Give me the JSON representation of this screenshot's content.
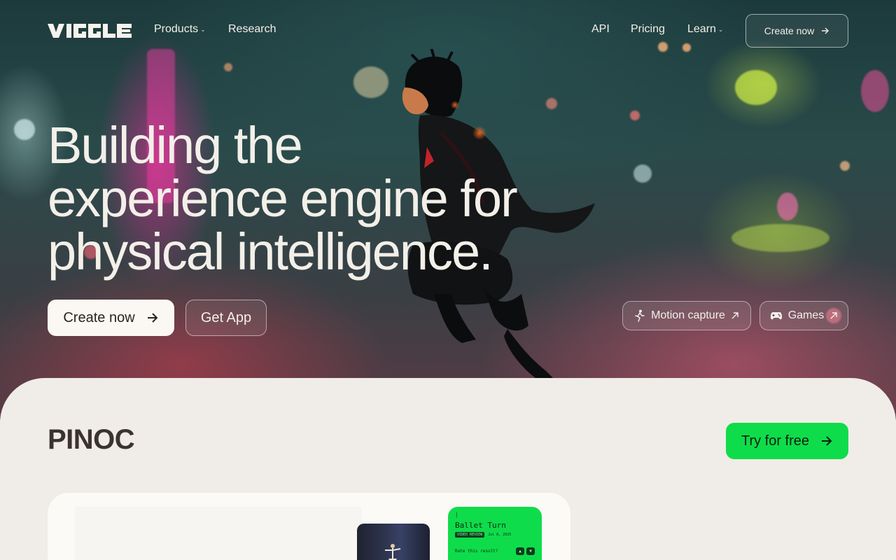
{
  "brand": {
    "name": "VIGGLE"
  },
  "nav": {
    "left": [
      {
        "label": "Products",
        "dropdown": true
      },
      {
        "label": "Research",
        "dropdown": false
      }
    ],
    "right": [
      {
        "label": "API",
        "dropdown": false
      },
      {
        "label": "Pricing",
        "dropdown": false
      },
      {
        "label": "Learn",
        "dropdown": true
      }
    ],
    "cta": {
      "label": "Create now",
      "icon": "arrow-right-icon"
    }
  },
  "hero": {
    "headline_lines": [
      "Building the",
      "experience engine for",
      "physical intelligence."
    ],
    "primary_button": {
      "label": "Create now",
      "icon": "arrow-right-icon"
    },
    "secondary_button": {
      "label": "Get App"
    },
    "pills": [
      {
        "label": "Motion capture",
        "icon": "running-person-icon",
        "trail_icon": "arrow-up-right-icon"
      },
      {
        "label": "Games",
        "icon": "gamepad-icon",
        "trail_icon": "arrow-up-right-icon"
      }
    ]
  },
  "section": {
    "title": "PINOC",
    "cta": {
      "label": "Try for free",
      "icon": "arrow-right-icon"
    },
    "preview_card": {
      "title": "Ballet Turn",
      "badge": "VIDEO REVIEW",
      "date": "Jul 8, 2025",
      "prompt": "Rate this result?"
    }
  },
  "colors": {
    "accent_green": "#0fdc4a",
    "cream": "#f0ece7",
    "text_dark": "#3b332f",
    "hero_text": "#f3efe9"
  }
}
